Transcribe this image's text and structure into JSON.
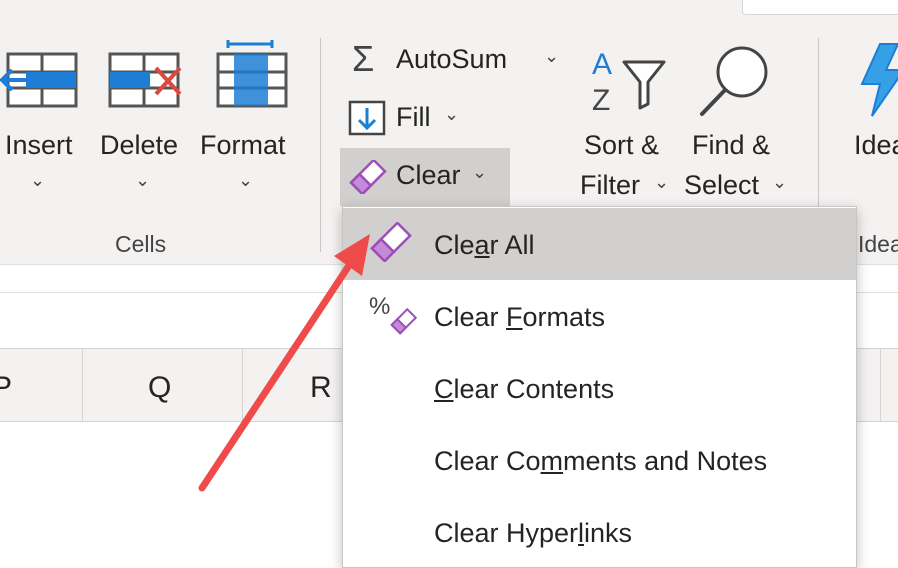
{
  "ribbon": {
    "cells": {
      "insert_label": "Insert",
      "delete_label": "Delete",
      "format_label": "Format",
      "group_label": "Cells"
    },
    "editing": {
      "autosum_label": "AutoSum",
      "fill_label": "Fill",
      "clear_label": "Clear",
      "sort_line1": "Sort &",
      "sort_line2": "Filter",
      "find_line1": "Find &",
      "find_line2": "Select"
    },
    "ideas": {
      "label": "Idea",
      "group_label": "Idea"
    }
  },
  "columns": [
    "P",
    "Q",
    "R"
  ],
  "clear_menu": {
    "items": [
      {
        "pre": "Cle",
        "key": "a",
        "post": "r All",
        "icon": "eraser-icon",
        "highlighted": true
      },
      {
        "pre": "Clear ",
        "key": "F",
        "post": "ormats",
        "icon": "percent-eraser-icon",
        "highlighted": false
      },
      {
        "pre": "",
        "key": "C",
        "post": "lear Contents",
        "icon": "",
        "highlighted": false
      },
      {
        "pre": "Clear Co",
        "key": "m",
        "post": "ments and Notes",
        "icon": "",
        "highlighted": false
      },
      {
        "pre": "Clear Hyper",
        "key": "l",
        "post": "inks",
        "icon": "",
        "highlighted": false
      }
    ]
  },
  "colors": {
    "ribbon_bg": "#f3f2f1",
    "highlight": "#d2d0ce",
    "accent_blue": "#1e7ed6",
    "eraser_purple": "#9b4fb7",
    "delete_red": "#e0483e",
    "arrow_red": "#ef4b4b"
  }
}
